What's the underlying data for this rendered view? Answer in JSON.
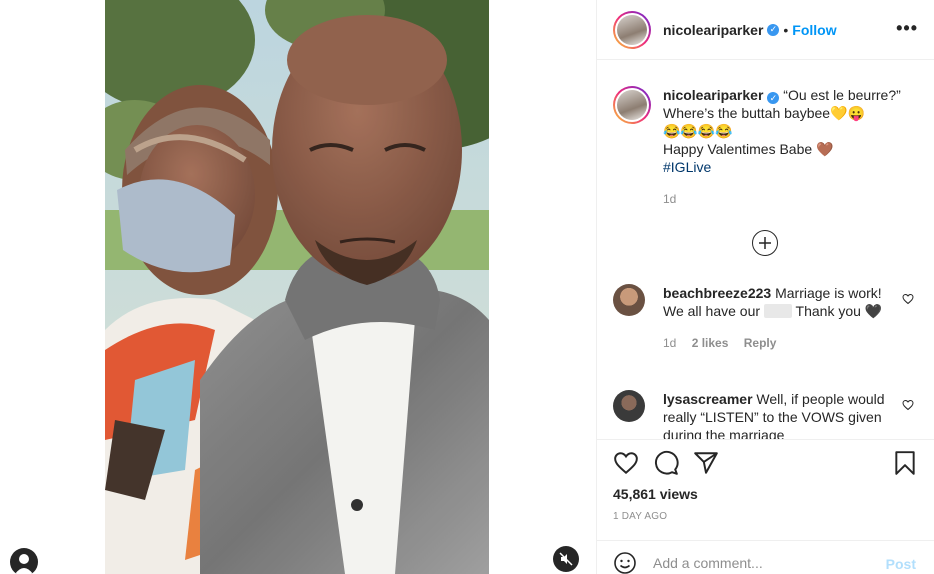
{
  "post": {
    "author": "nicoleariparker",
    "follow_label": "Follow",
    "more_label": "•••",
    "dot": "•"
  },
  "caption": {
    "username": "nicoleariparker",
    "line1": "“Ou est le beurre?”",
    "line2": "Where’s the buttah baybee💛😛",
    "line3": "😂😂😂😂",
    "line4": "Happy Valentimes Babe 🤎",
    "hashtag": "#IGLive",
    "age": "1d"
  },
  "comments": [
    {
      "username": "beachbreeze223",
      "text_before": "Marriage is work! We all have our",
      "text_after": "Thank you 🖤",
      "age": "1d",
      "likes": "2 likes",
      "reply": "Reply",
      "avatar_color": "#6a5142"
    },
    {
      "username": "lysascreamer",
      "text": "Well, if people would really “LISTEN” to the VOWS given during the marriage",
      "avatar_color": "#3a3a3a"
    }
  ],
  "stats": {
    "views": "45,861 views",
    "age": "1 DAY AGO"
  },
  "composer": {
    "placeholder": "Add a comment...",
    "post_label": "Post"
  },
  "icons": {
    "like": "heart-icon",
    "comment": "comment-icon",
    "share": "share-icon",
    "save": "bookmark-icon",
    "emoji": "smiley-icon",
    "load_more": "plus-circle-icon",
    "mute": "speaker-muted-icon",
    "verified": "verified-badge-icon"
  },
  "colors": {
    "accent": "#0095f6",
    "post_disabled": "#b2dffc",
    "muted_text": "#8e8e8e",
    "verified": "#3897f0"
  }
}
